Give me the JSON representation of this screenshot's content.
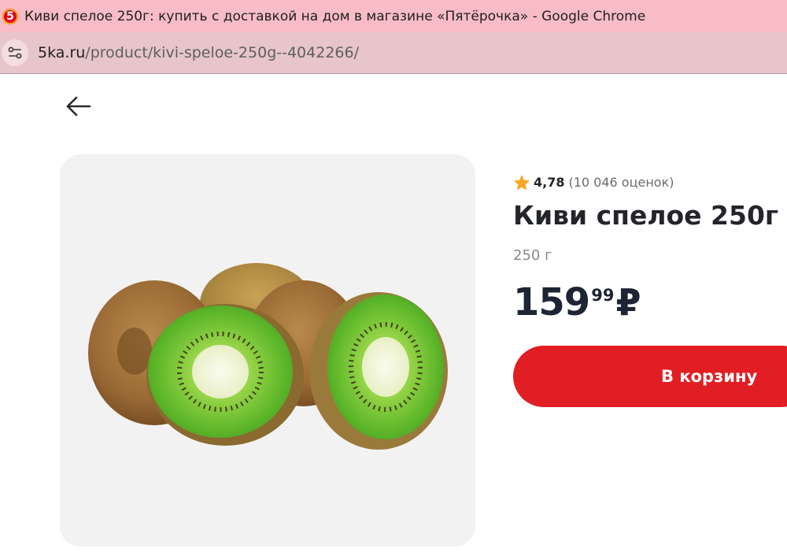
{
  "browser": {
    "window_title": "Киви спелое 250г: купить с доставкой на дом в магазине «Пятёрочка» - Google Chrome",
    "favicon_text": "5",
    "url_domain": "5ka.ru",
    "url_path": "/product/kivi-speloe-250g--4042266/"
  },
  "product": {
    "rating": "4,78",
    "rating_count": "(10 046 оценок)",
    "title": "Киви спелое 250г",
    "weight": "250 г",
    "price_rub": "159",
    "price_kop": "99",
    "currency": "₽",
    "cart_button": "В корзину"
  },
  "icons": {
    "back": "arrow-left-icon",
    "site_info": "tune-icon",
    "rating": "star-icon"
  },
  "colors": {
    "accent_red": "#e11e24",
    "star": "#f5a623",
    "title_bar": "#f7bcc6"
  }
}
